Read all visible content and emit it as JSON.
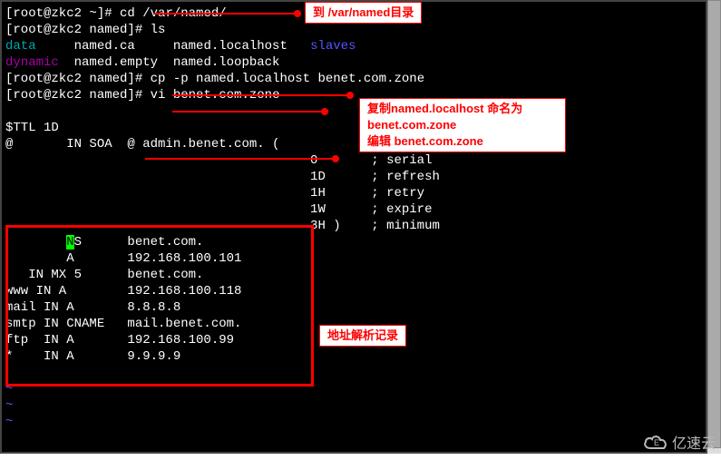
{
  "prompts": {
    "line1_prefix": "[root@zkc2 ~]# ",
    "line1_cmd": "cd /var/named/",
    "line2_prefix": "[root@zkc2 named]# ",
    "line2_cmd": "ls",
    "line3_data": "data",
    "line3_mid": "     named.ca     named.localhost   ",
    "line3_slaves": "slaves",
    "line4_dynamic": "dynamic",
    "line4_rest": "  named.empty  named.loopback",
    "line5_prefix": "[root@zkc2 named]# ",
    "line5_cmd": "cp -p named.localhost benet.com.zone",
    "line6_prefix": "[root@zkc2 named]# ",
    "line6_cmd": "vi benet.com.zone"
  },
  "zone": {
    "ttl": "$TTL 1D",
    "soa": "@       IN SOA  @ admin.benet.com. (",
    "serial": "                                        0       ; serial",
    "refresh": "                                        1D      ; refresh",
    "retry": "                                        1H      ; retry",
    "expire": "                                        1W      ; expire",
    "minimum": "                                        3H )    ; minimum",
    "ns_prefix": "        ",
    "ns_n": "N",
    "ns_rest": "S      benet.com.",
    "a1": "        A       192.168.100.101",
    "mx": "   IN MX 5      benet.com.",
    "www": "www IN A        192.168.100.118",
    "mail": "mail IN A       8.8.8.8",
    "smtp": "smtp IN CNAME   mail.benet.com.",
    "ftp": "ftp  IN A       192.168.100.99",
    "star": "*    IN A       9.9.9.9"
  },
  "tildes": {
    "t1": "~",
    "t2": "~",
    "t3": "~"
  },
  "annotations": {
    "a1": "到 /var/named目录",
    "a2_l1": "复制named.localhost 命名为",
    "a2_l2": "benet.com.zone",
    "a2_l3": "编辑 benet.com.zone",
    "a3": "地址解析记录"
  },
  "watermark": "亿速云"
}
